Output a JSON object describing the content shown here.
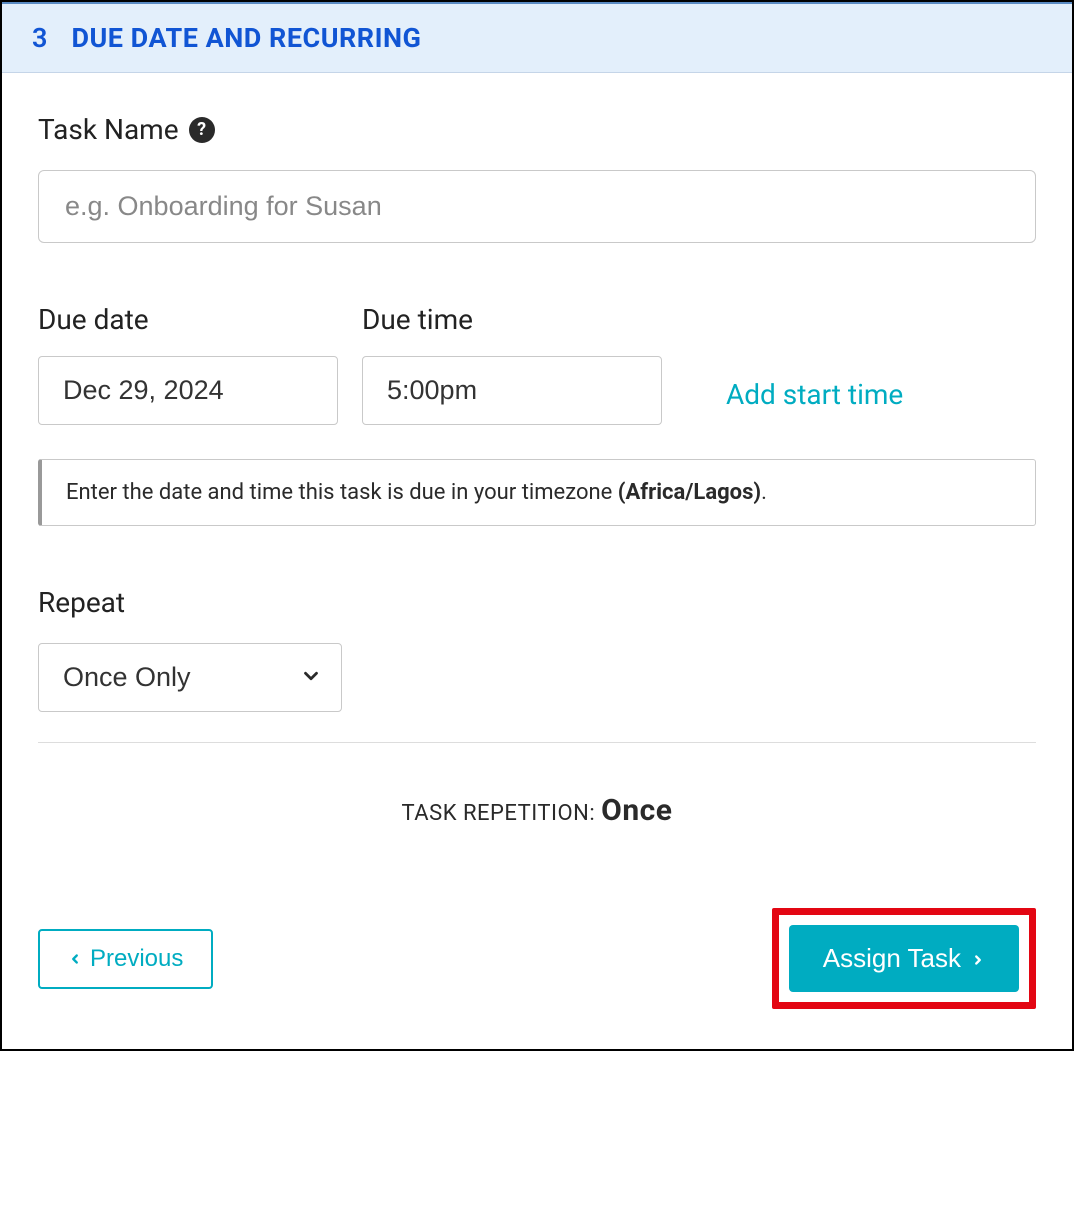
{
  "header": {
    "step_number": "3",
    "title": "DUE DATE AND RECURRING"
  },
  "task_name": {
    "label": "Task Name",
    "placeholder": "e.g. Onboarding for Susan",
    "value": ""
  },
  "due": {
    "date_label": "Due date",
    "date_value": "Dec 29, 2024",
    "time_label": "Due time",
    "time_value": "5:00pm",
    "add_start_link": "Add start time"
  },
  "info": {
    "prefix": "Enter the date and time this task is due in your timezone ",
    "timezone": "(Africa/Lagos)",
    "suffix": "."
  },
  "repeat": {
    "label": "Repeat",
    "value": "Once Only"
  },
  "repetition_summary": {
    "label": "TASK REPETITION: ",
    "value": "Once"
  },
  "actions": {
    "previous": "Previous",
    "assign": "Assign Task"
  }
}
